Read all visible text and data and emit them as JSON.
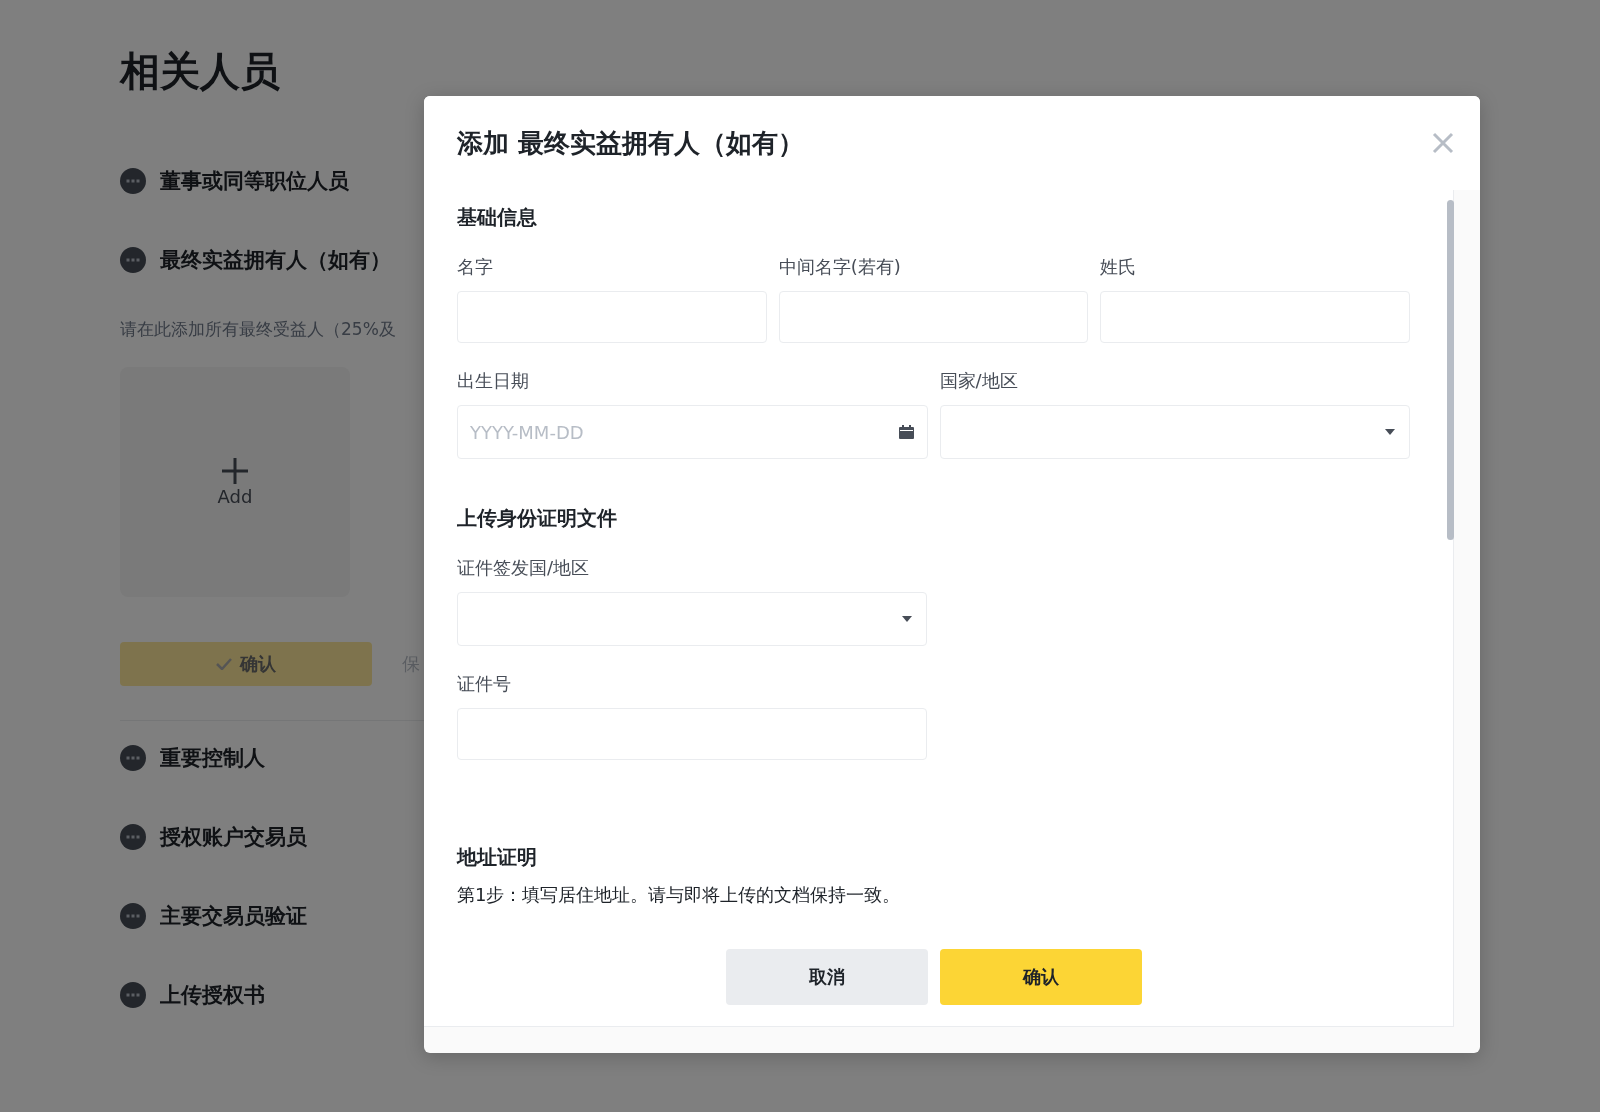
{
  "page": {
    "title": "相关人员",
    "steps": [
      {
        "label": "董事或同等职位人员"
      },
      {
        "label": "最终实益拥有人（如有）"
      }
    ],
    "description": "请在此添加所有最终受益人（25%及",
    "add_card": {
      "label": "Add"
    },
    "confirm_button": "确认",
    "save_link": "保",
    "more_steps": [
      {
        "label": "重要控制人"
      },
      {
        "label": "授权账户交易员"
      },
      {
        "label": "主要交易员验证"
      },
      {
        "label": "上传授权书"
      }
    ]
  },
  "dialog": {
    "title": "添加 最终实益拥有人（如有）",
    "sections": [
      {
        "title": "基础信息",
        "rows": [
          [
            {
              "label": "名字",
              "kind": "text"
            },
            {
              "label": "中间名字(若有)",
              "kind": "text"
            },
            {
              "label": "姓氏",
              "kind": "text"
            }
          ],
          [
            {
              "label": "出生日期",
              "kind": "date",
              "placeholder": "YYYY-MM-DD"
            },
            {
              "label": "国家/地区",
              "kind": "select"
            }
          ]
        ]
      },
      {
        "title": "上传身份证明文件",
        "rows": [
          [
            {
              "label": "证件签发国/地区",
              "kind": "select"
            }
          ],
          [
            {
              "label": "证件号",
              "kind": "text"
            }
          ]
        ]
      },
      {
        "title": "地址证明",
        "note": "第1步：填写居住地址。请与即将上传的文档保持一致。"
      }
    ],
    "buttons": [
      {
        "label": "取消",
        "kind": "secondary"
      },
      {
        "label": "确认",
        "kind": "primary"
      }
    ]
  }
}
